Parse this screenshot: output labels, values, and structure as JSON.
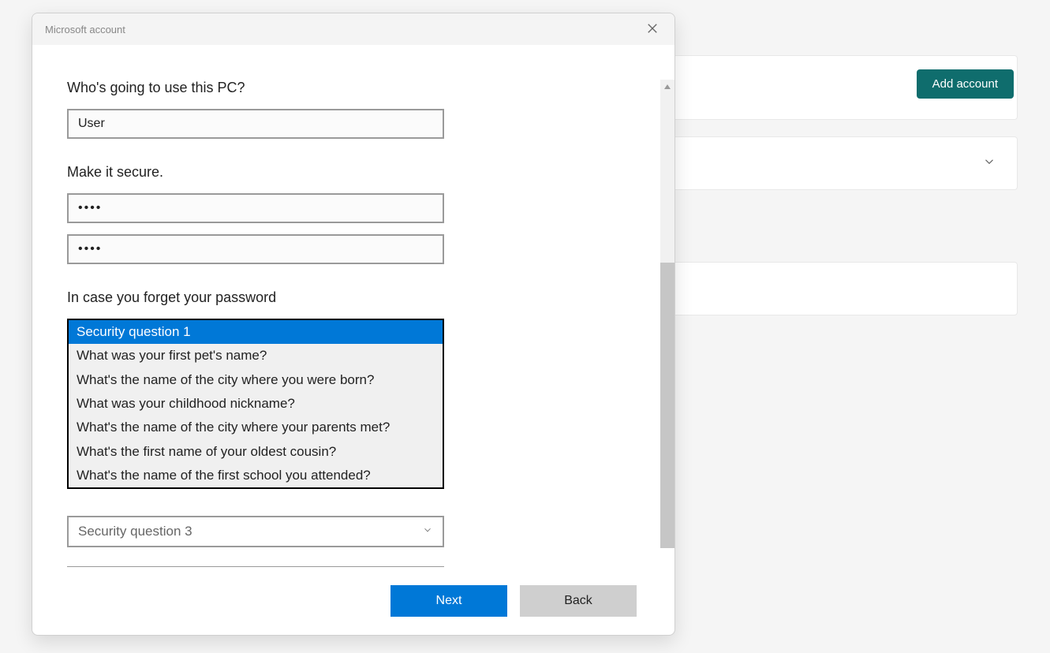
{
  "background": {
    "add_account_label": "Add account"
  },
  "dialog": {
    "title": "Microsoft account",
    "prompts": {
      "who": "Who's going to use this PC?",
      "secure": "Make it secure.",
      "forget": "In case you forget your password"
    },
    "fields": {
      "username_value": "User",
      "password_value": "••••",
      "confirm_value": "••••",
      "sq3_placeholder": "Security question 3"
    },
    "dropdown": {
      "options": [
        "Security question 1",
        "What was your first pet's name?",
        "What's the name of the city where you were born?",
        "What was your childhood nickname?",
        "What's the name of the city where your parents met?",
        "What's the first name of your oldest cousin?",
        "What's the name of the first school you attended?"
      ]
    },
    "buttons": {
      "next": "Next",
      "back": "Back"
    }
  }
}
